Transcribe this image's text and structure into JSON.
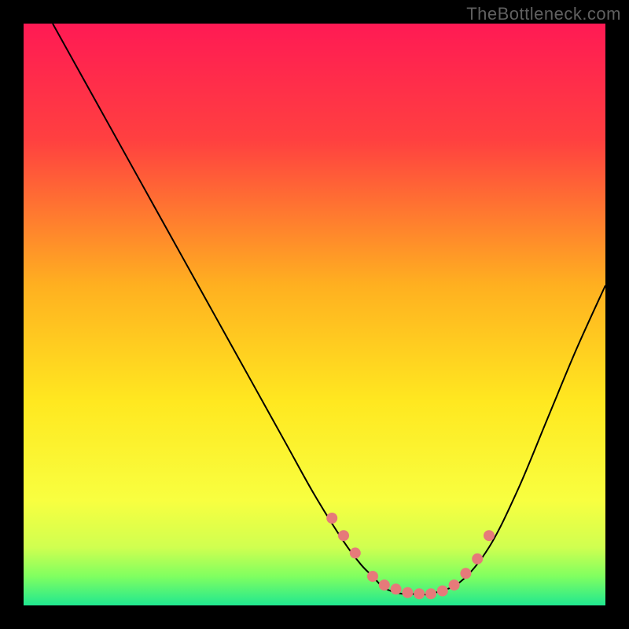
{
  "watermark": "TheBottleneck.com",
  "chart_data": {
    "type": "line",
    "title": "",
    "xlabel": "",
    "ylabel": "",
    "xlim": [
      0,
      100
    ],
    "ylim": [
      0,
      100
    ],
    "gradient_stops": [
      {
        "offset": 0.0,
        "color": "#ff1a54"
      },
      {
        "offset": 0.2,
        "color": "#ff4040"
      },
      {
        "offset": 0.45,
        "color": "#ffb020"
      },
      {
        "offset": 0.65,
        "color": "#ffe820"
      },
      {
        "offset": 0.82,
        "color": "#f8ff40"
      },
      {
        "offset": 0.9,
        "color": "#d0ff50"
      },
      {
        "offset": 0.95,
        "color": "#80ff60"
      },
      {
        "offset": 1.0,
        "color": "#20e890"
      }
    ],
    "series": [
      {
        "name": "bottleneck-curve",
        "x": [
          5,
          10,
          15,
          20,
          25,
          30,
          35,
          40,
          45,
          50,
          55,
          58,
          60,
          62,
          65,
          68,
          70,
          75,
          80,
          85,
          90,
          95,
          100
        ],
        "y": [
          100,
          91,
          82,
          73,
          64,
          55,
          46,
          37,
          28,
          19,
          11,
          7,
          5,
          3,
          2,
          2,
          2,
          4,
          10,
          20,
          32,
          44,
          55
        ]
      }
    ],
    "markers": {
      "name": "highlight-points",
      "color": "#e67a7a",
      "x": [
        53,
        55,
        57,
        60,
        62,
        64,
        66,
        68,
        70,
        72,
        74,
        76,
        78,
        80
      ],
      "y": [
        15,
        12,
        9,
        5,
        3.5,
        2.8,
        2.2,
        2,
        2,
        2.5,
        3.5,
        5.5,
        8,
        12
      ]
    }
  }
}
